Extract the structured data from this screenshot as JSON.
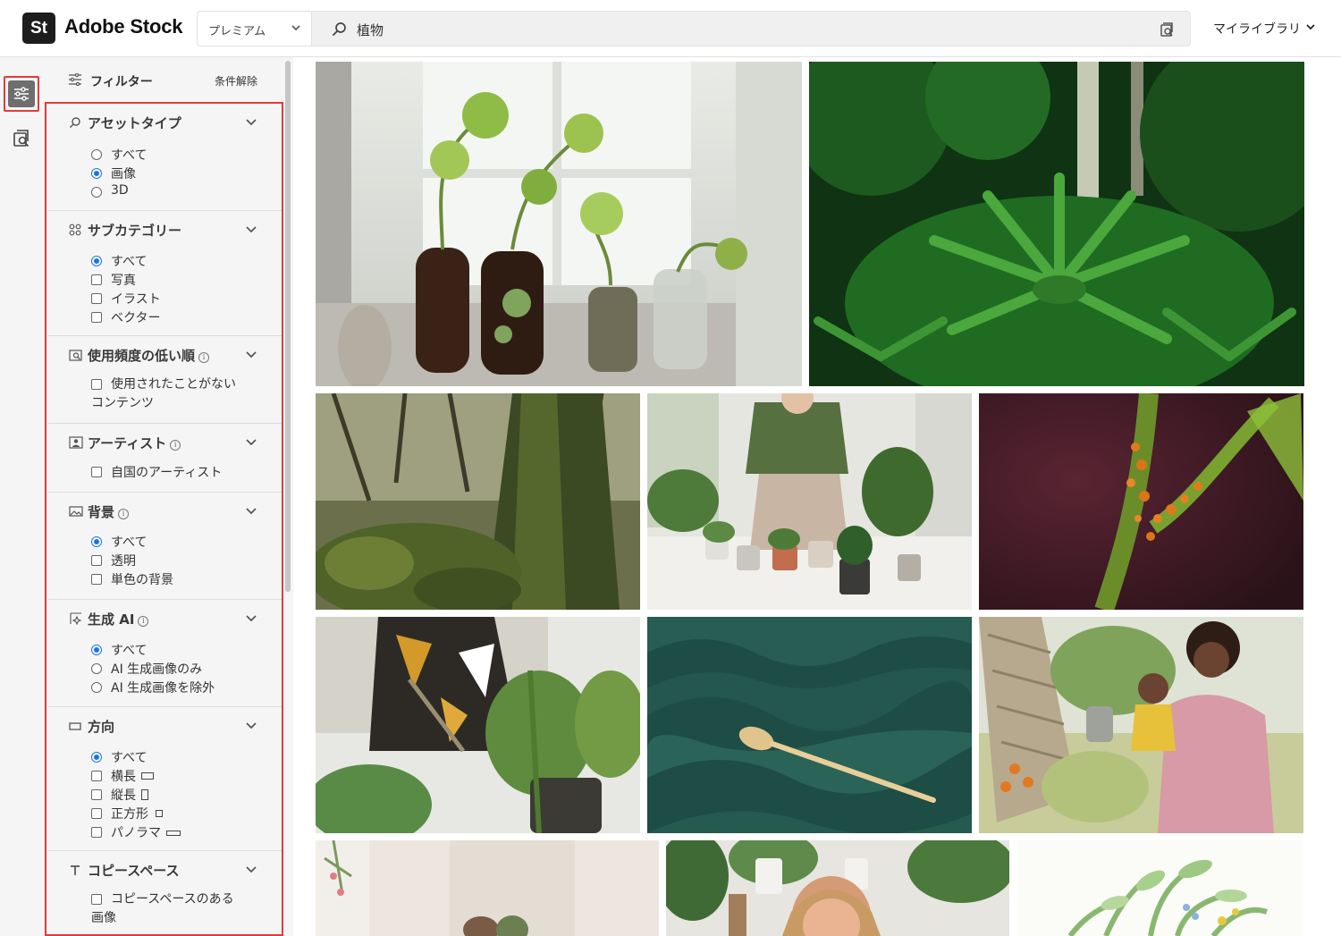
{
  "app": {
    "logo_mark": "St",
    "logo_name": "Adobe Stock"
  },
  "search": {
    "tier": "プレミアム",
    "query": "植物"
  },
  "header": {
    "library": "マイライブラリ"
  },
  "filters": {
    "title": "フィルター",
    "clear": "条件解除",
    "sections": {
      "asset_type": {
        "title": "アセットタイプ",
        "options": [
          "すべて",
          "画像",
          "3D"
        ],
        "selected": "画像"
      },
      "subcategory": {
        "title": "サブカテゴリー",
        "options": [
          "すべて",
          "写真",
          "イラスト",
          "ベクター"
        ],
        "selected": "すべて"
      },
      "usage": {
        "title": "使用頻度の低い順",
        "options": [
          "使用されたことがないコンテンツ"
        ]
      },
      "artist": {
        "title": "アーティスト",
        "options": [
          "自国のアーティスト"
        ]
      },
      "background": {
        "title": "背景",
        "options": [
          "すべて",
          "透明",
          "単色の背景"
        ],
        "selected": "すべて"
      },
      "gen_ai": {
        "title": "生成 AI",
        "options": [
          "すべて",
          "AI 生成画像のみ",
          "AI 生成画像を除外"
        ],
        "selected": "すべて"
      },
      "orientation": {
        "title": "方向",
        "options": [
          "すべて",
          "横長",
          "縦長",
          "正方形",
          "パノラマ"
        ],
        "selected": "すべて"
      },
      "copy_space": {
        "title": "コピースペース",
        "options": [
          "コピースペースのある画像"
        ]
      }
    }
  },
  "results": [
    "plants-in-bottles-on-windowsill",
    "fern-forest",
    "mossy-tree-trunk",
    "woman-potting-plants",
    "aphids-on-stem",
    "pruning-plant-with-shears",
    "green-texture-with-spoon",
    "mother-and-baby-with-plants",
    "woman-with-plant",
    "smiling-woman-with-plants",
    "plant-illustration"
  ],
  "colors": {
    "accent": "#1a73e8",
    "highlight": "#e43a3a"
  }
}
